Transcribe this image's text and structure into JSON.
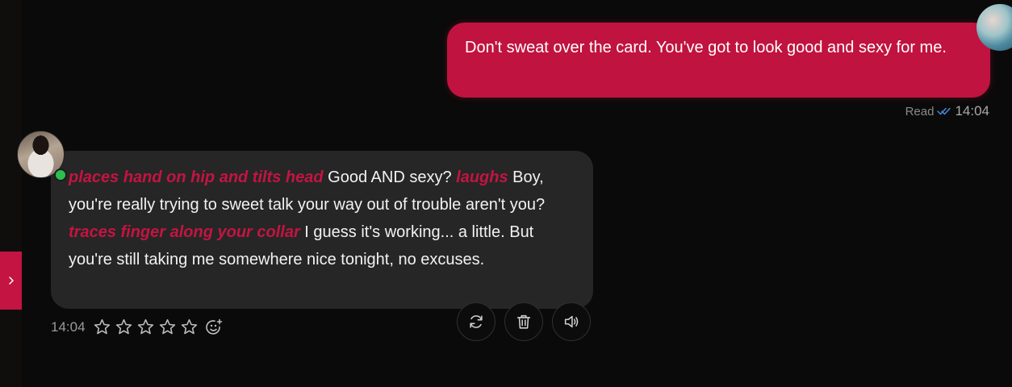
{
  "user_message": {
    "text": "Don't sweat over the card. You've got to look good and sexy for me.",
    "status": "Read",
    "time": "14:04"
  },
  "bot_message": {
    "segments": [
      {
        "type": "action",
        "text": "places hand on hip and tilts head"
      },
      {
        "type": "speech",
        "text": " Good AND sexy? "
      },
      {
        "type": "action",
        "text": "laughs"
      },
      {
        "type": "speech",
        "text": " Boy, you're really trying to sweet talk your way out of trouble aren't you? "
      },
      {
        "type": "action",
        "text": "traces finger along your collar"
      },
      {
        "type": "speech",
        "text": " I guess it's working... a little. But you're still taking me somewhere nice tonight, no excuses."
      }
    ],
    "time": "14:04",
    "rating": 0,
    "rating_max": 5
  },
  "colors": {
    "accent": "#c41442",
    "user_bubble": "#c1133f",
    "bot_bubble": "#262626",
    "online": "#2ebd4f"
  },
  "icons": {
    "sidebar_toggle": "chevron-right-icon",
    "read_receipt": "double-check-icon",
    "regenerate": "refresh-icon",
    "delete": "trash-icon",
    "speak": "speaker-icon",
    "react": "smiley-plus-icon",
    "star": "star-outline-icon"
  }
}
